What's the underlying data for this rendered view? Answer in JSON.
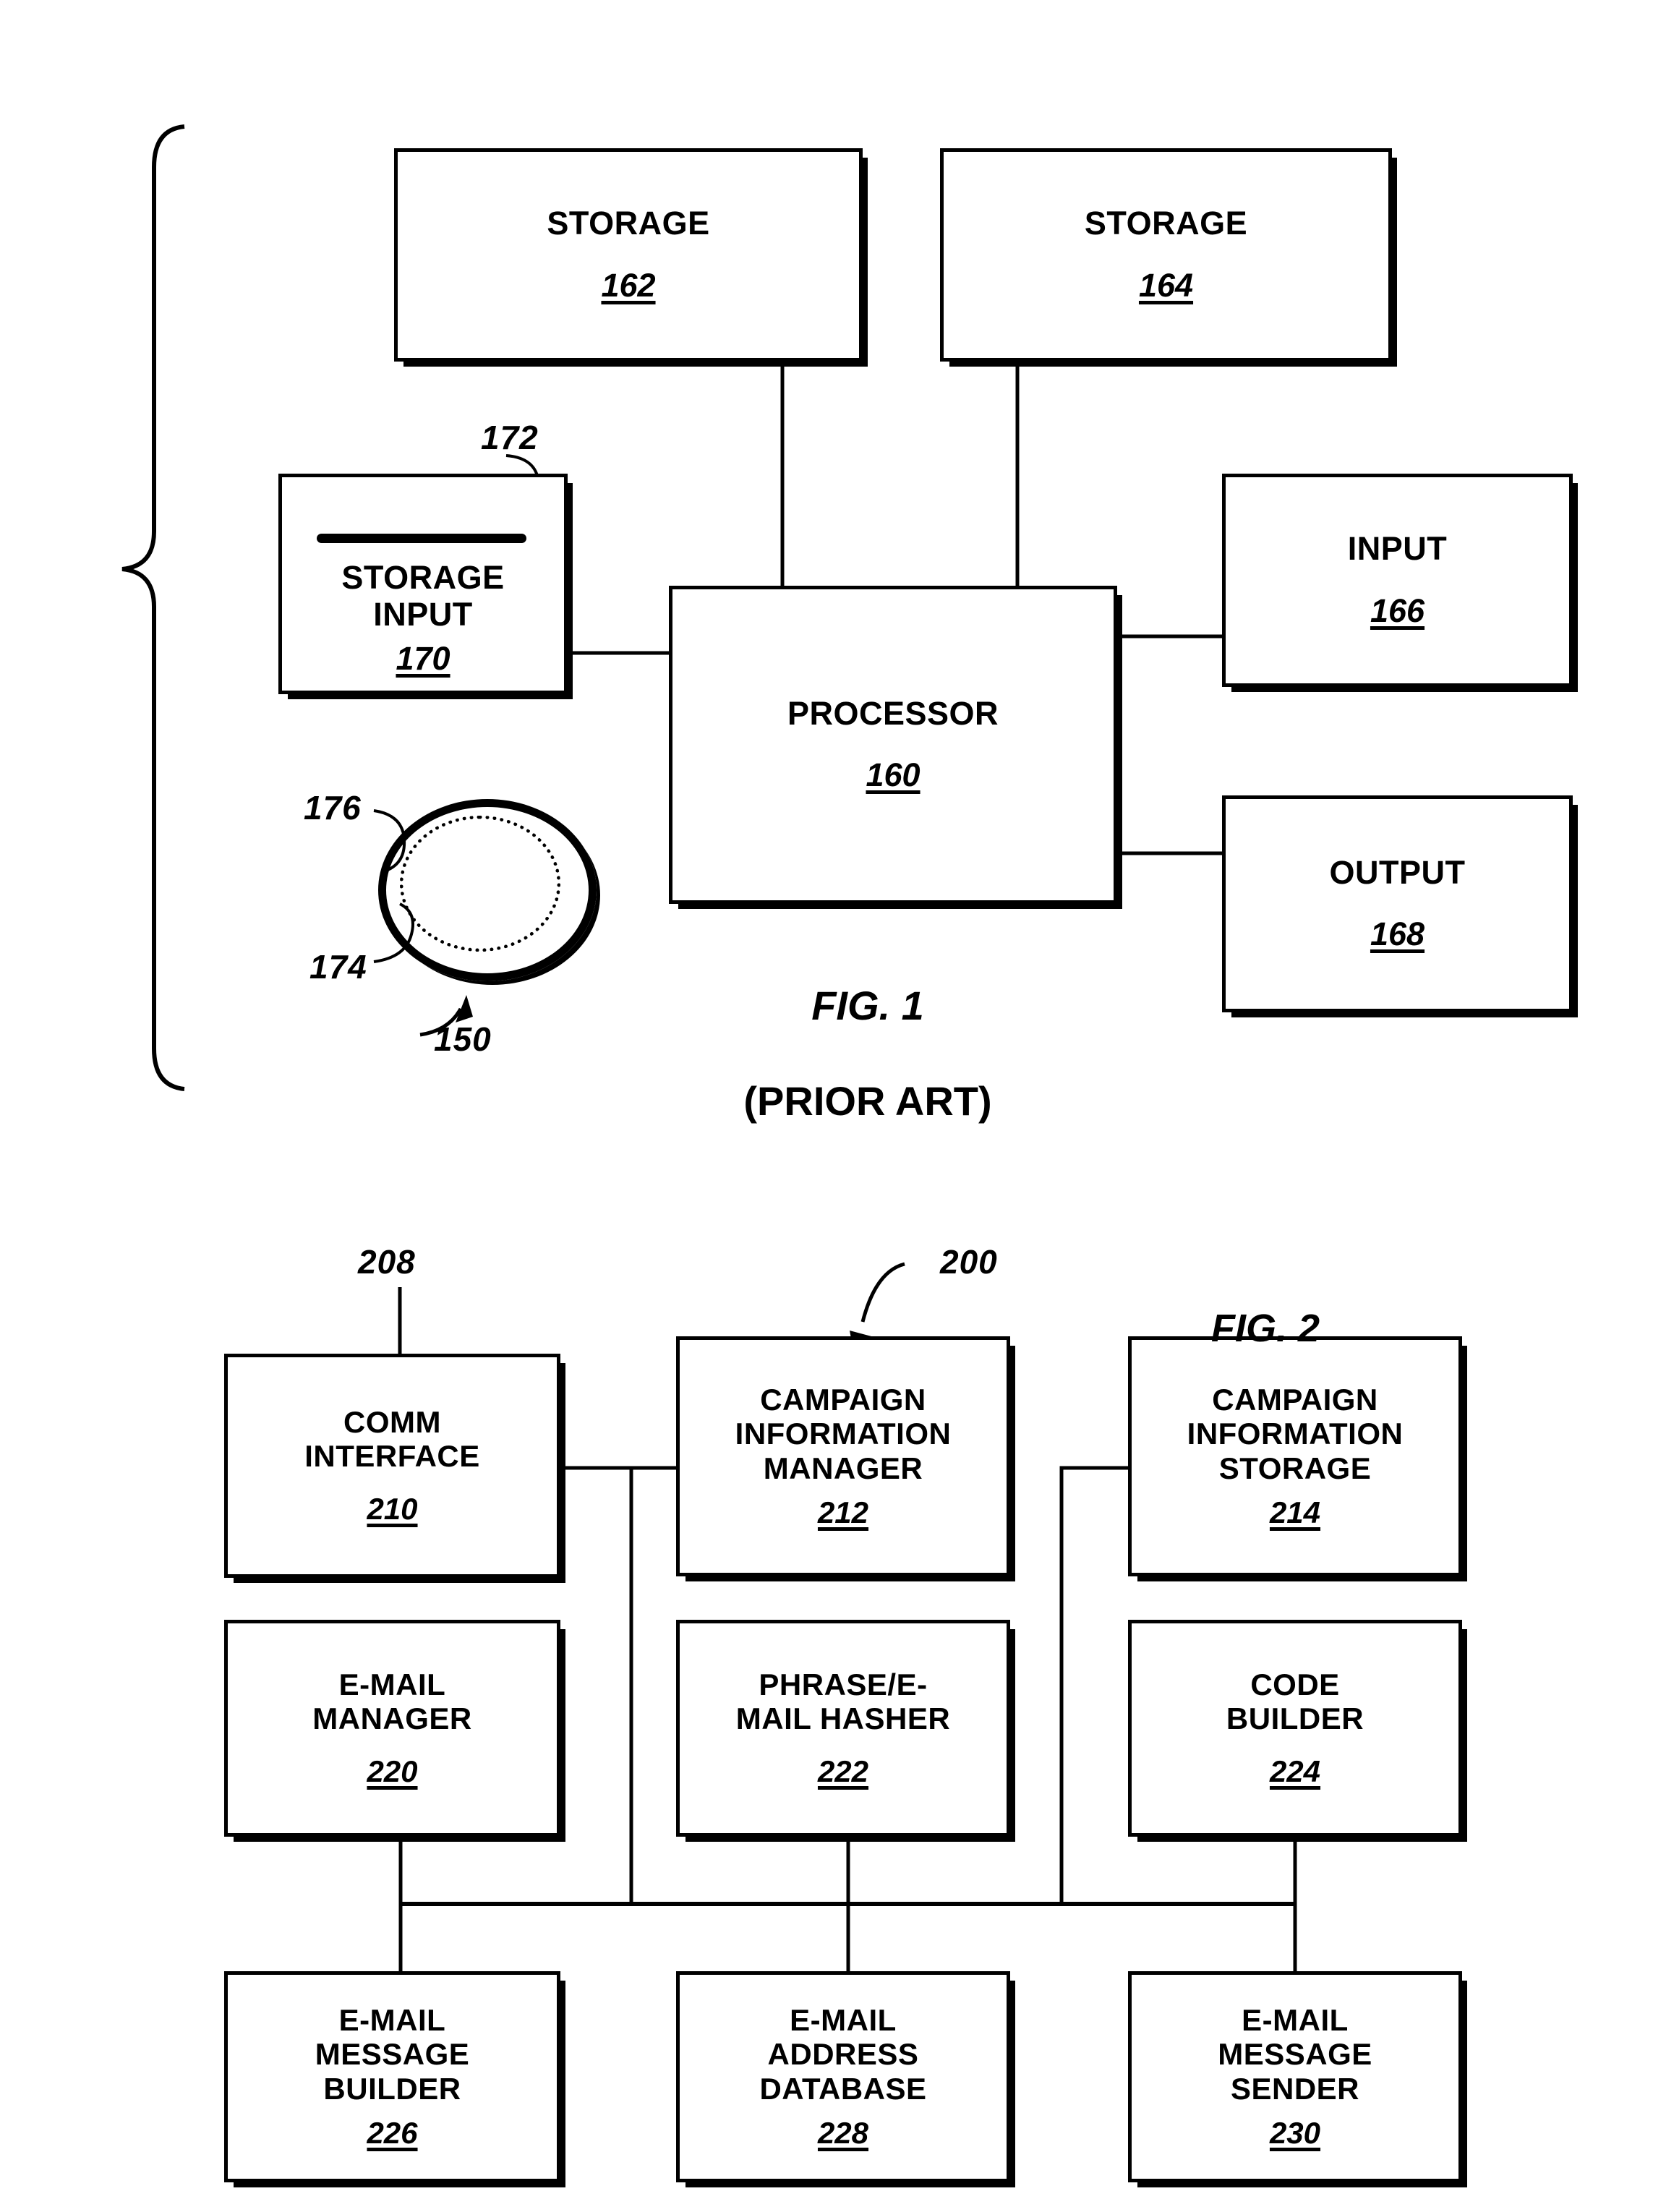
{
  "sheet": {
    "figures": [
      {
        "id": "fig1",
        "caption_line1": "FIG. 1",
        "caption_line2": "(PRIOR ART)",
        "system_ref": "150"
      },
      {
        "id": "fig2",
        "caption_line1": "FIG. 2",
        "system_ref": "200"
      }
    ]
  },
  "fig1": {
    "caption": {
      "line1": "FIG. 1",
      "line2": "(PRIOR ART)"
    },
    "boxes": [
      {
        "key": "storage_162",
        "title": "STORAGE",
        "num": "162"
      },
      {
        "key": "storage_164",
        "title": "STORAGE",
        "num": "164"
      },
      {
        "key": "storage_input_170",
        "title": "STORAGE\nINPUT",
        "num": "170"
      },
      {
        "key": "processor_160",
        "title": "PROCESSOR",
        "num": "160"
      },
      {
        "key": "input_166",
        "title": "INPUT",
        "num": "166"
      },
      {
        "key": "output_168",
        "title": "OUTPUT",
        "num": "168"
      }
    ],
    "refs": [
      {
        "key": "slot_172",
        "label": "172"
      },
      {
        "key": "disk_176",
        "label": "176"
      },
      {
        "key": "disk_174",
        "label": "174"
      },
      {
        "key": "system_150",
        "label": "150"
      }
    ]
  },
  "fig2": {
    "caption": {
      "line1": "FIG. 2"
    },
    "boxes": [
      {
        "key": "comm_interface_210",
        "title": "COMM\nINTERFACE",
        "num": "210"
      },
      {
        "key": "campaign_info_mgr_212",
        "title": "CAMPAIGN\nINFORMATION\nMANAGER",
        "num": "212"
      },
      {
        "key": "campaign_info_sto_214",
        "title": "CAMPAIGN\nINFORMATION\nSTORAGE",
        "num": "214"
      },
      {
        "key": "email_manager_220",
        "title": "E-MAIL\nMANAGER",
        "num": "220"
      },
      {
        "key": "phrase_hasher_222",
        "title": "PHRASE/E-\nMAIL HASHER",
        "num": "222"
      },
      {
        "key": "code_builder_224",
        "title": "CODE\nBUILDER",
        "num": "224"
      },
      {
        "key": "msg_builder_226",
        "title": "E-MAIL\nMESSAGE\nBUILDER",
        "num": "226"
      },
      {
        "key": "addr_database_228",
        "title": "E-MAIL\nADDRESS\nDATABASE",
        "num": "228"
      },
      {
        "key": "msg_sender_230",
        "title": "E-MAIL\nMESSAGE\nSENDER",
        "num": "230"
      }
    ],
    "refs": [
      {
        "key": "network_208",
        "label": "208"
      },
      {
        "key": "system_200",
        "label": "200"
      }
    ]
  },
  "style": {
    "ink": "#000000",
    "paper": "#ffffff"
  }
}
